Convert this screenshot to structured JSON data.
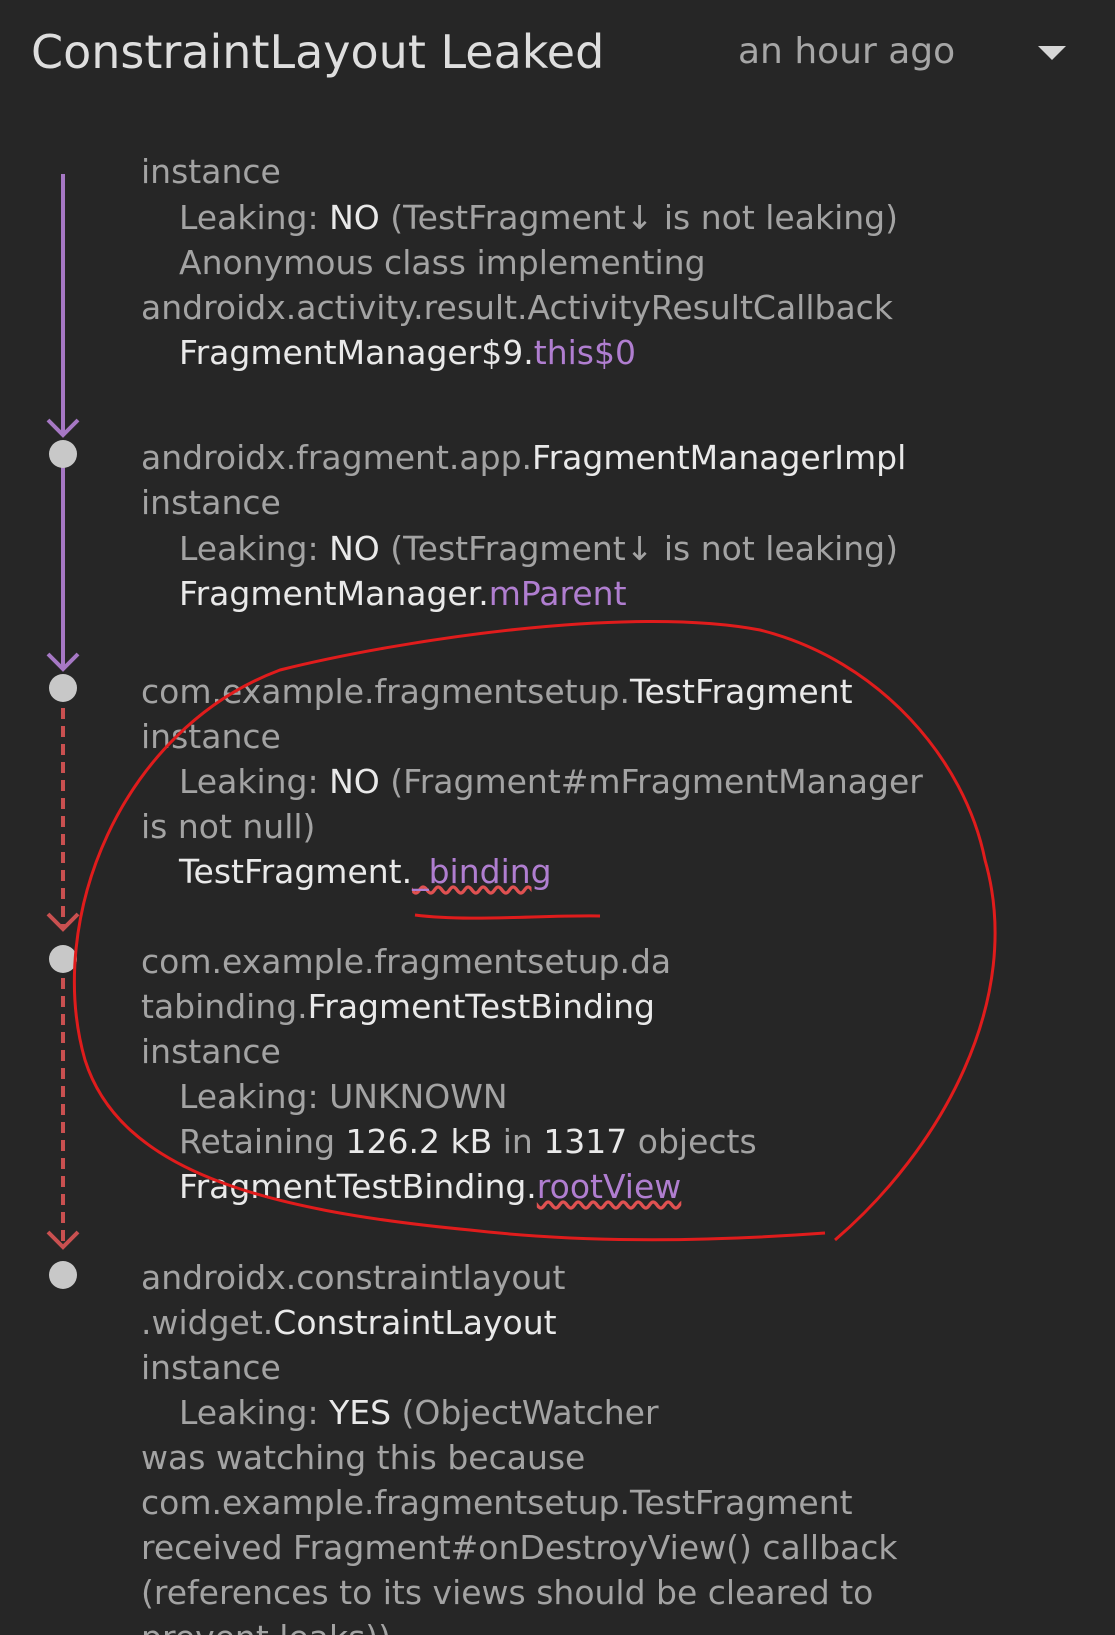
{
  "header": {
    "title": "ConstraintLayout Leaked",
    "time": "an hour ago"
  },
  "colors": {
    "background": "#262626",
    "reference_line": "#a678c4",
    "suspect_line": "#c95050",
    "annotation": "#e01c1c"
  },
  "trace": {
    "n0": {
      "l0": "instance",
      "l1a": "Leaking: ",
      "l1b": "NO",
      "l1c": " (TestFragment↓ is not leaking)",
      "l2": "Anonymous class implementing",
      "l3": "androidx.activity.result.ActivityResultCallback",
      "l4a": "FragmentManager$9.",
      "l4b": "this$0"
    },
    "n1": {
      "l0a": "androidx.fragment.app.",
      "l0b": "FragmentManagerImpl",
      "l1": "instance",
      "l2a": "Leaking: ",
      "l2b": "NO",
      "l2c": " (TestFragment↓ is not leaking)",
      "l3a": "FragmentManager.",
      "l3b": "mParent"
    },
    "n2": {
      "l0a": "com.example.fragmentsetup.",
      "l0b": "TestFragment",
      "l1": "instance",
      "l2a": "Leaking: ",
      "l2b": "NO",
      "l2c": " (Fragment#mFragmentManager",
      "l3": "is not null)",
      "l4a": "TestFragment.",
      "l4b": "_binding"
    },
    "n3": {
      "l0": "com.example.fragmentsetup.da",
      "l1a": "tabinding.",
      "l1b": "FragmentTestBinding",
      "l2": "instance",
      "l3": "Leaking: UNKNOWN",
      "l4a": "Retaining ",
      "l4b": "126.2 kB",
      "l4c": " in ",
      "l4d": "1317",
      "l4e": " objects",
      "l5a": "FragmentTestBinding.",
      "l5b": "rootView"
    },
    "n4": {
      "l0": "androidx.constraintlayout",
      "l1a": ".widget.",
      "l1b": "ConstraintLayout",
      "l2": "instance",
      "l3a": "Leaking: ",
      "l3b": "YES",
      "l3c": " (ObjectWatcher",
      "l4": "was watching this because",
      "l5": "com.example.fragmentsetup.TestFragment",
      "l6": "received Fragment#onDestroyView() callback",
      "l7": "(references to its views should be cleared to",
      "l8": "prevent leaks))"
    }
  }
}
